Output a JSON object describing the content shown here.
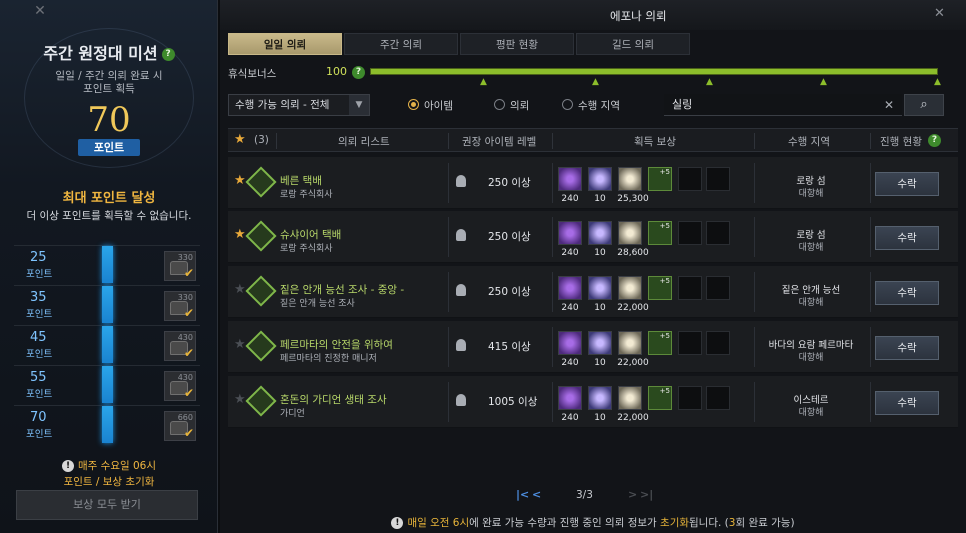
{
  "left": {
    "title": "주간 원정대 미션",
    "subtitle1": "일일 / 주간 의뢰 완료 시",
    "subtitle2": "포인트 획득",
    "points": "70",
    "points_label": "포인트",
    "max_title": "최대 포인트 달성",
    "max_sub": "더 이상 포인트를 획득할 수 없습니다.",
    "tiers": [
      {
        "points": "25",
        "label": "포인트",
        "chest": "330"
      },
      {
        "points": "35",
        "label": "포인트",
        "chest": "330"
      },
      {
        "points": "45",
        "label": "포인트",
        "chest": "430"
      },
      {
        "points": "55",
        "label": "포인트",
        "chest": "430"
      },
      {
        "points": "70",
        "label": "포인트",
        "chest": "660"
      }
    ],
    "reset_line1": "매주 수요일 06시",
    "reset_line2": "포인트 / 보상 초기화",
    "claim_all": "보상 모두 받기"
  },
  "main": {
    "window_title": "에포나 의뢰",
    "tabs": [
      {
        "label": "일일 의뢰",
        "active": true
      },
      {
        "label": "주간 의뢰",
        "active": false
      },
      {
        "label": "평판 현황",
        "active": false
      },
      {
        "label": "길드 의뢰",
        "active": false
      }
    ],
    "rest_bonus_label": "휴식보너스",
    "rest_bonus_value": "100",
    "filter": {
      "select_value": "수행 가능 의뢰 - 전체",
      "radios": [
        {
          "label": "아이템",
          "checked": true
        },
        {
          "label": "의뢰",
          "checked": false
        },
        {
          "label": "수행 지역",
          "checked": false
        }
      ],
      "search_value": "실링"
    },
    "headers": {
      "fav_count": "(3)",
      "list": "의뢰 리스트",
      "level": "권장 아이템 레벨",
      "reward": "획득 보상",
      "region": "수행 지역",
      "progress": "진행 현황"
    },
    "quests": [
      {
        "fav": true,
        "name": "베른 택배",
        "sub": "로랑 주식회사",
        "level": "250 이상",
        "rewards": [
          "240",
          "10",
          "25,300"
        ],
        "region": "로랑 섬",
        "region_sub": "대항해",
        "button": "수락"
      },
      {
        "fav": true,
        "name": "슈샤이어 택배",
        "sub": "로랑 주식회사",
        "level": "250 이상",
        "rewards": [
          "240",
          "10",
          "28,600"
        ],
        "region": "로랑 섬",
        "region_sub": "대항해",
        "button": "수락"
      },
      {
        "fav": false,
        "name": "짙은 안개 능선 조사 - 중앙 -",
        "sub": "짙은 안개 능선 조사",
        "level": "250 이상",
        "rewards": [
          "240",
          "10",
          "22,000"
        ],
        "region": "짙은 안개 능선",
        "region_sub": "대항해",
        "button": "수락"
      },
      {
        "fav": false,
        "name": "페르마타의 안전을 위하여",
        "sub": "페르마타의 진정한 매니저",
        "level": "415 이상",
        "rewards": [
          "240",
          "10",
          "22,000"
        ],
        "region": "바다의 요람 페르마타",
        "region_sub": "대항해",
        "button": "수락"
      },
      {
        "fav": false,
        "name": "혼돈의 가디언 생태 조사",
        "sub": "가디언",
        "level": "1005 이상",
        "rewards": [
          "240",
          "10",
          "22,000"
        ],
        "region": "이스테르",
        "region_sub": "대항해",
        "button": "수락"
      }
    ],
    "pager": "3/3",
    "footer_pre": "매일 오전 ",
    "footer_time": "6시",
    "footer_mid": "에 완료 가능 수량과 진행 중인 의뢰 정보가 ",
    "footer_reset": "초기화",
    "footer_mid2": "됩니다. (",
    "footer_count": "3",
    "footer_post": "회 완료 가능)"
  },
  "colors": {
    "accent_gold": "#f0b640",
    "rest_green": "#8cbd2b",
    "tier_blue": "#2aa5ea",
    "quest_green": "#b8d86a"
  }
}
